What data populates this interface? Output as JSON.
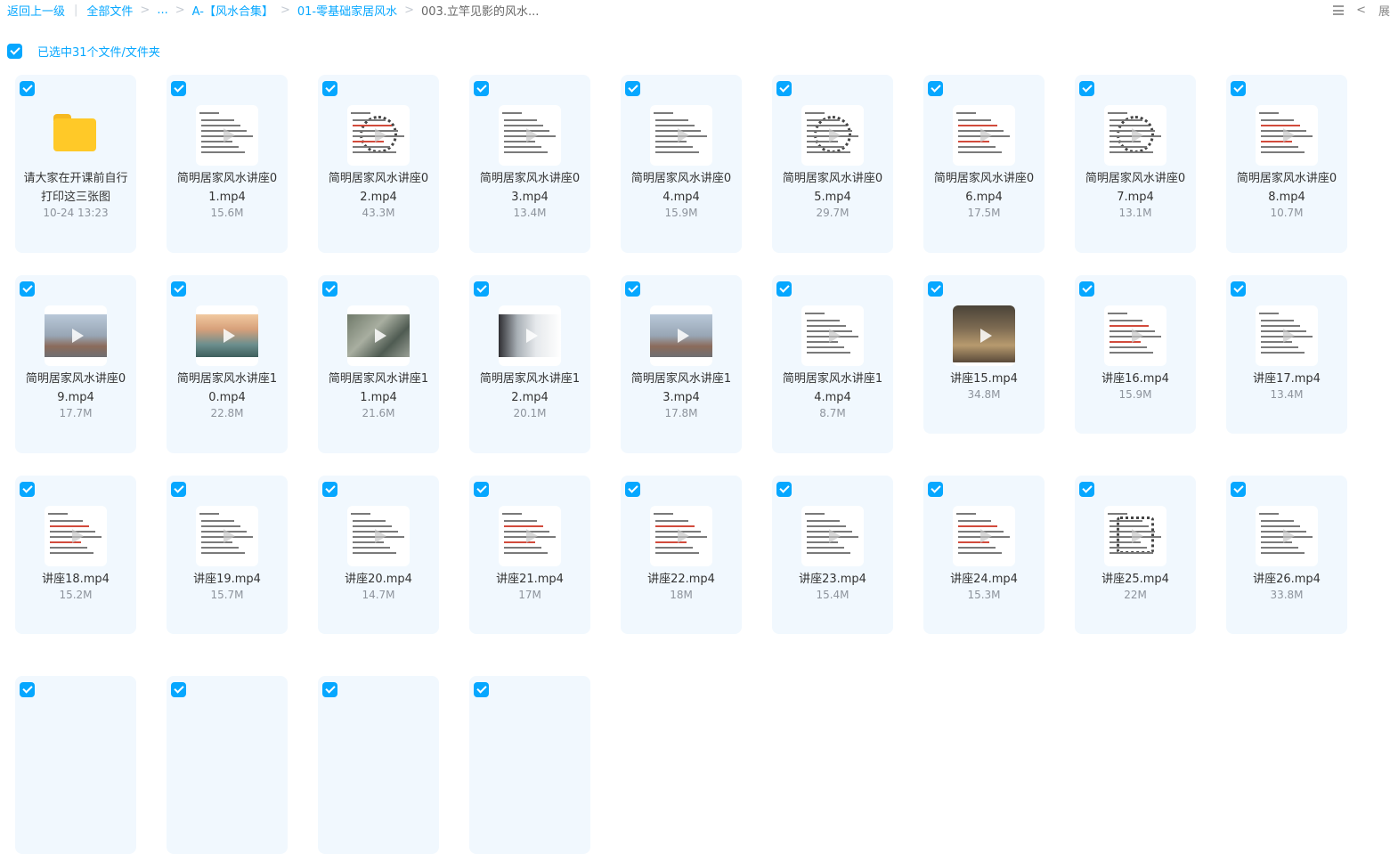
{
  "breadcrumb": {
    "back": "返回上一级",
    "all_files": "全部文件",
    "ellipsis": "...",
    "folder1": "A-【风水合集】",
    "folder2": "01-零基础家居风水",
    "current": "003.立竿见影的风水..."
  },
  "top_right": {
    "expand_label": "展"
  },
  "selection": {
    "text": "已选中31个文件/文件夹"
  },
  "colors": {
    "accent": "#06a7ff",
    "tile_bg": "#f1f8fe",
    "folder": "#ffc928"
  },
  "items": [
    {
      "name": "请大家在开课前自行打印这三张图",
      "meta": "10-24 13:23",
      "type": "folder"
    },
    {
      "name": "简明居家风水讲座01.mp4",
      "meta": "15.6M",
      "type": "video",
      "thumb": "doc"
    },
    {
      "name": "简明居家风水讲座02.mp4",
      "meta": "43.3M",
      "type": "video",
      "thumb": "bagua"
    },
    {
      "name": "简明居家风水讲座03.mp4",
      "meta": "13.4M",
      "type": "video",
      "thumb": "doc"
    },
    {
      "name": "简明居家风水讲座04.mp4",
      "meta": "15.9M",
      "type": "video",
      "thumb": "doc"
    },
    {
      "name": "简明居家风水讲座05.mp4",
      "meta": "29.7M",
      "type": "video",
      "thumb": "compass"
    },
    {
      "name": "简明居家风水讲座06.mp4",
      "meta": "17.5M",
      "type": "video",
      "thumb": "doc-red"
    },
    {
      "name": "简明居家风水讲座07.mp4",
      "meta": "13.1M",
      "type": "video",
      "thumb": "compass"
    },
    {
      "name": "简明居家风水讲座08.mp4",
      "meta": "10.7M",
      "type": "video",
      "thumb": "doc-red"
    },
    {
      "name": "简明居家风水讲座09.mp4",
      "meta": "17.7M",
      "type": "video",
      "thumb": "city"
    },
    {
      "name": "简明居家风水讲座10.mp4",
      "meta": "22.8M",
      "type": "video",
      "thumb": "landscape"
    },
    {
      "name": "简明居家风水讲座11.mp4",
      "meta": "21.6M",
      "type": "video",
      "thumb": "aerial"
    },
    {
      "name": "简明居家风水讲座12.mp4",
      "meta": "20.1M",
      "type": "video",
      "thumb": "tower"
    },
    {
      "name": "简明居家风水讲座13.mp4",
      "meta": "17.8M",
      "type": "video",
      "thumb": "city"
    },
    {
      "name": "简明居家风水讲座14.mp4",
      "meta": "8.7M",
      "type": "video",
      "thumb": "doc"
    },
    {
      "name": "讲座15.mp4",
      "meta": "34.8M",
      "type": "video",
      "thumb": "house"
    },
    {
      "name": "讲座16.mp4",
      "meta": "15.9M",
      "type": "video",
      "thumb": "doc-red"
    },
    {
      "name": "讲座17.mp4",
      "meta": "13.4M",
      "type": "video",
      "thumb": "doc"
    },
    {
      "name": "讲座18.mp4",
      "meta": "15.2M",
      "type": "video",
      "thumb": "doc-red"
    },
    {
      "name": "讲座19.mp4",
      "meta": "15.7M",
      "type": "video",
      "thumb": "doc"
    },
    {
      "name": "讲座20.mp4",
      "meta": "14.7M",
      "type": "video",
      "thumb": "doc"
    },
    {
      "name": "讲座21.mp4",
      "meta": "17M",
      "type": "video",
      "thumb": "doc-red"
    },
    {
      "name": "讲座22.mp4",
      "meta": "18M",
      "type": "video",
      "thumb": "doc-red"
    },
    {
      "name": "讲座23.mp4",
      "meta": "15.4M",
      "type": "video",
      "thumb": "doc"
    },
    {
      "name": "讲座24.mp4",
      "meta": "15.3M",
      "type": "video",
      "thumb": "doc-red"
    },
    {
      "name": "讲座25.mp4",
      "meta": "22M",
      "type": "video",
      "thumb": "diagram"
    },
    {
      "name": "讲座26.mp4",
      "meta": "33.8M",
      "type": "video",
      "thumb": "doc"
    },
    {
      "name": "",
      "meta": "",
      "type": "partial"
    },
    {
      "name": "",
      "meta": "",
      "type": "partial"
    },
    {
      "name": "",
      "meta": "",
      "type": "partial"
    },
    {
      "name": "",
      "meta": "",
      "type": "partial"
    }
  ]
}
